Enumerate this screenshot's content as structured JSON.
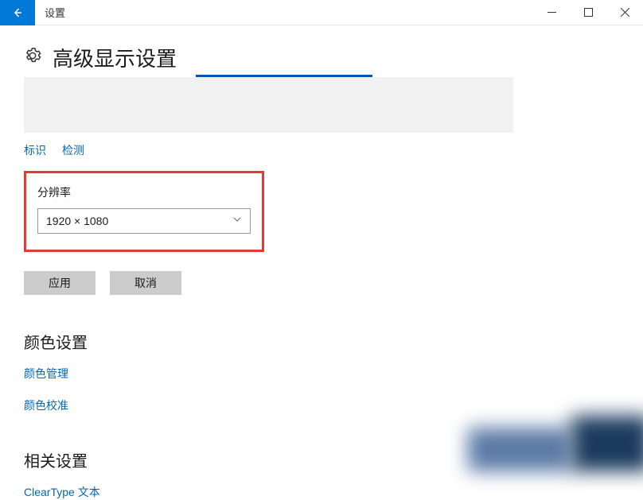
{
  "titlebar": {
    "title": "设置"
  },
  "page": {
    "heading": "高级显示设置"
  },
  "links": {
    "identify": "标识",
    "detect": "检测"
  },
  "resolution": {
    "label": "分辨率",
    "value": "1920 × 1080"
  },
  "buttons": {
    "apply": "应用",
    "cancel": "取消"
  },
  "colorSection": {
    "heading": "颜色设置",
    "manage": "颜色管理",
    "calibrate": "颜色校准"
  },
  "relatedSection": {
    "heading": "相关设置",
    "cleartype": "ClearType 文本"
  }
}
